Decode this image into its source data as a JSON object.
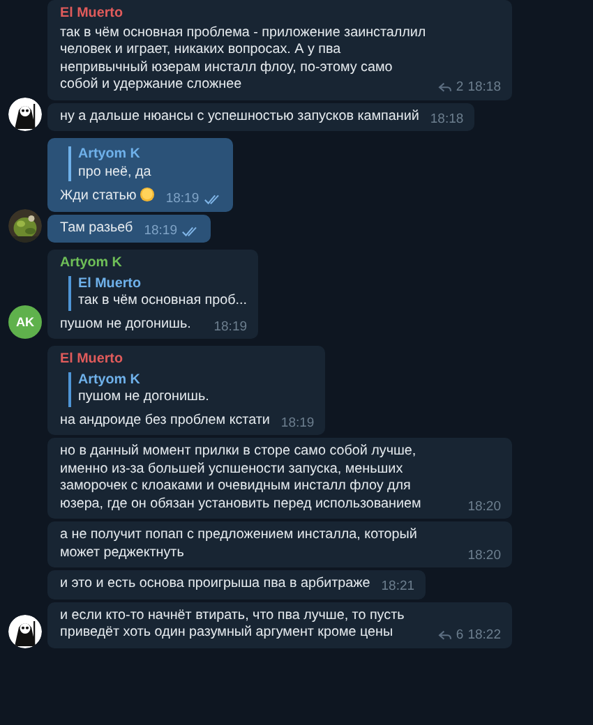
{
  "groups": [
    {
      "avatar": {
        "kind": "skull"
      },
      "messages": [
        {
          "outgoing": false,
          "author": {
            "name": "El Muerto",
            "color": "#e05b5b"
          },
          "text": "так в чём основная проблема - приложение заинсталлил человек и играет, никаких вопросах. А у пва непривычный юзерам инсталл флоу, по-этому само собой и удержание сложнее",
          "replies": "2",
          "time": "18:18"
        },
        {
          "outgoing": false,
          "text": "ну а дальше нюансы с успешностью запусков кампаний",
          "time": "18:18"
        }
      ]
    },
    {
      "messages": [
        {
          "outgoing": true,
          "quote": {
            "author": "Artyom K",
            "text": "про неё, да"
          },
          "text": "Жди статью",
          "emoji": true,
          "time": "18:19",
          "read": true
        },
        {
          "outgoing": true,
          "text": "Там разьеб",
          "time": "18:19",
          "read": true
        }
      ]
    },
    {
      "avatar": {
        "kind": "initials",
        "text": "AK",
        "color": "#5fb14c"
      },
      "messages": [
        {
          "outgoing": false,
          "author": {
            "name": "Artyom K",
            "color": "#6fbf58"
          },
          "quote": {
            "author": "El Muerto",
            "text": "так в чём основная проб..."
          },
          "text": "пушом не догонишь.",
          "time": "18:19"
        }
      ]
    },
    {
      "avatar": {
        "kind": "skull"
      },
      "messages": [
        {
          "outgoing": false,
          "author": {
            "name": "El Muerto",
            "color": "#e05b5b"
          },
          "quote": {
            "author": "Artyom K",
            "text": "пушом не догонишь."
          },
          "text": "на андроиде без проблем кстати",
          "time": "18:19"
        },
        {
          "outgoing": false,
          "text": "но в данный момент прилки в сторе само собой лучше, именно из-за большей успшености запуска, меньших заморочек с клоаками и очевидным инсталл флоу для юзера, где он обязан установить перед использованием",
          "time": "18:20"
        },
        {
          "outgoing": false,
          "text": "а не получит попап с предложением инсталла, который может реджектнуть",
          "time": "18:20"
        },
        {
          "outgoing": false,
          "text": "и это и есть основа проигрыша пва в арбитраже",
          "time": "18:21"
        },
        {
          "outgoing": false,
          "text": "и если кто-то начнёт втирать, что пва лучше, то пусть приведёт хоть один разумный аргумент кроме цены",
          "replies": "6",
          "time": "18:22"
        }
      ]
    }
  ]
}
